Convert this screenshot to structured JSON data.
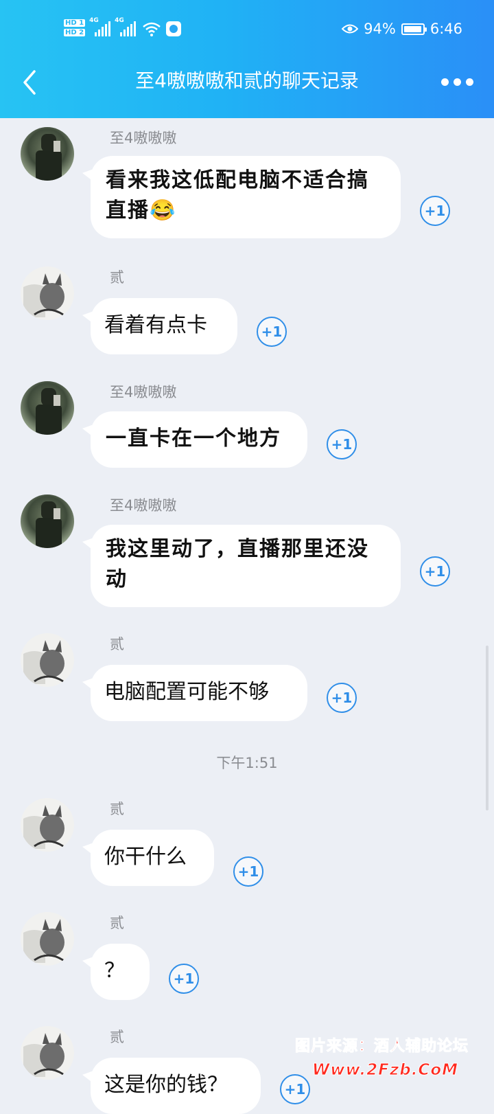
{
  "status_bar": {
    "hd1": "HD 1",
    "hd2": "HD 2",
    "net1": "4G",
    "net2": "4G",
    "battery_pct": "94%",
    "time": "6:46"
  },
  "nav": {
    "title": "至4嗷嗷嗷和贰的聊天记录",
    "back_icon": "chevron-left-icon",
    "more_icon": "more-dots-icon"
  },
  "messages": [
    {
      "sender": "至4嗷嗷嗷",
      "text": "看来我这低配电脑不适合搞直播",
      "emoji": "😂",
      "plus": "+1"
    },
    {
      "sender": "贰",
      "text": "看着有点卡",
      "plus": "+1"
    },
    {
      "sender": "至4嗷嗷嗷",
      "text": "一直卡在一个地方",
      "plus": "+1"
    },
    {
      "sender": "至4嗷嗷嗷",
      "text": "我这里动了，直播那里还没动",
      "plus": "+1"
    },
    {
      "sender": "贰",
      "text": "电脑配置可能不够",
      "plus": "+1"
    },
    {
      "sender": "贰",
      "text": "你干什么",
      "plus": "+1"
    },
    {
      "sender": "贰",
      "text": "？",
      "plus": "+1"
    },
    {
      "sender": "贰",
      "text": "这是你的钱？",
      "plus": "+1"
    }
  ],
  "timestamp": "下午1:51",
  "watermark": {
    "line1": "图片来源：酒人辅助论坛",
    "line2": "Www.2Fzb.CoM"
  }
}
